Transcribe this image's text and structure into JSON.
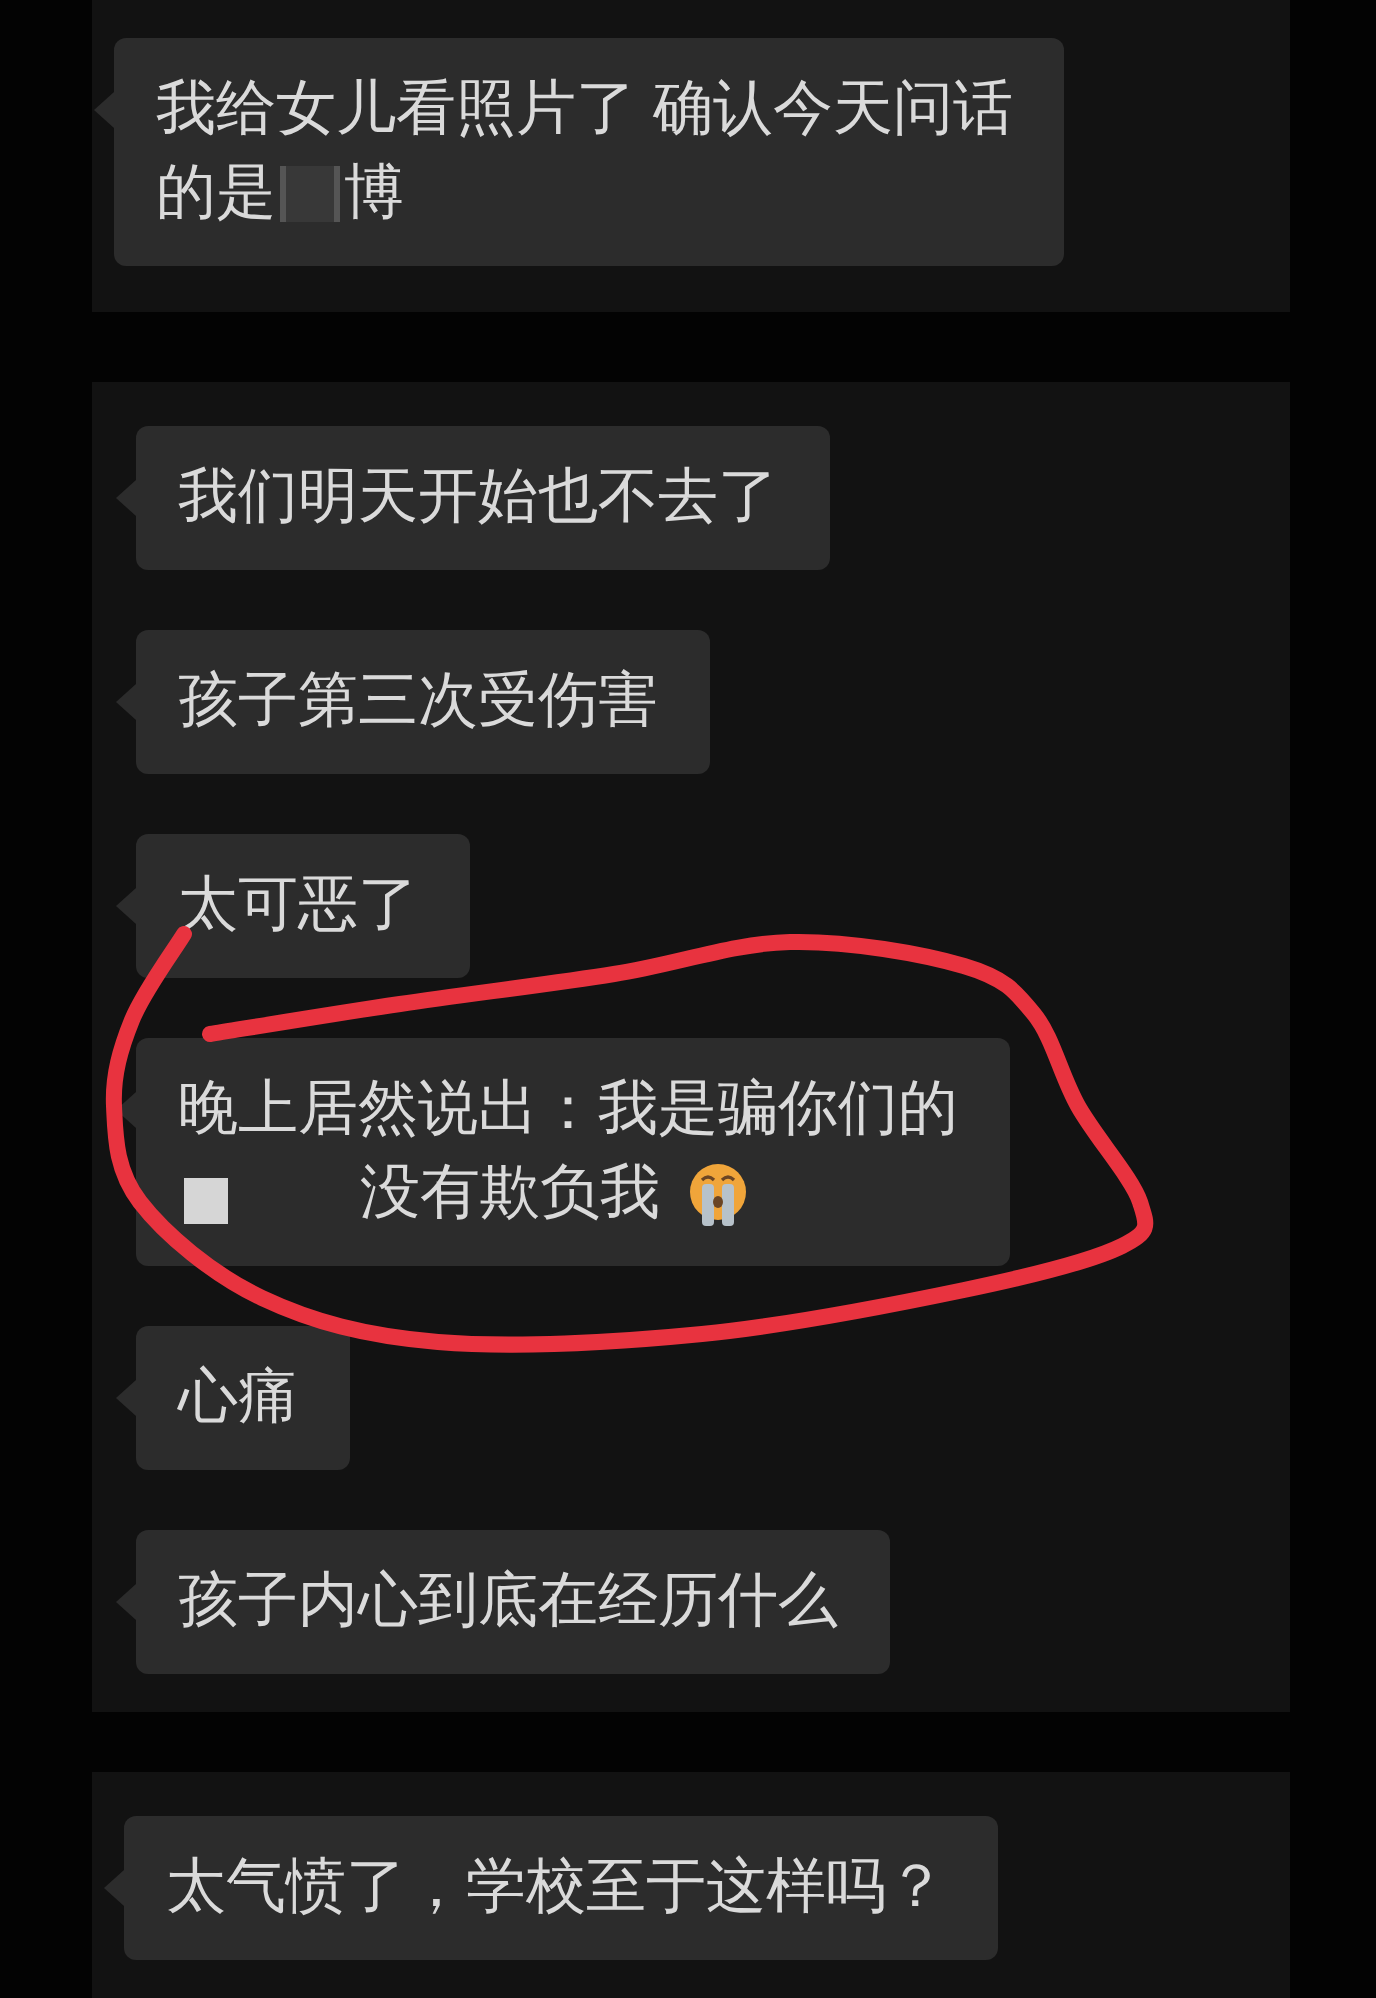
{
  "screenshots": [
    {
      "messages": [
        {
          "circled": false,
          "lines": [
            [
              {
                "kind": "text",
                "text": "我给女儿看照片了 确认今天问话"
              }
            ],
            [
              {
                "kind": "text",
                "text": "的是"
              },
              {
                "kind": "blur"
              },
              {
                "kind": "text",
                "text": "博"
              }
            ]
          ]
        }
      ]
    },
    {
      "messages": [
        {
          "circled": false,
          "lines": [
            [
              {
                "kind": "text",
                "text": "我们明天开始也不去了"
              }
            ]
          ]
        },
        {
          "circled": false,
          "lines": [
            [
              {
                "kind": "text",
                "text": "孩子第三次受伤害"
              }
            ]
          ]
        },
        {
          "circled": false,
          "lines": [
            [
              {
                "kind": "text",
                "text": "太可恶了"
              }
            ]
          ]
        },
        {
          "circled": true,
          "lines": [
            [
              {
                "kind": "text",
                "text": "晚上居然说出：我是骗你们的"
              }
            ],
            [
              {
                "kind": "block"
              },
              {
                "kind": "text",
                "text": "没有欺负我"
              },
              {
                "kind": "emoji"
              }
            ]
          ]
        },
        {
          "circled": false,
          "lines": [
            [
              {
                "kind": "text",
                "text": "心痛"
              }
            ]
          ]
        },
        {
          "circled": false,
          "lines": [
            [
              {
                "kind": "text",
                "text": "孩子内心到底在经历什么"
              }
            ]
          ]
        }
      ]
    },
    {
      "messages": [
        {
          "circled": false,
          "lines": [
            [
              {
                "kind": "text",
                "text": "太气愤了，学校至于这样吗？"
              }
            ]
          ]
        }
      ]
    }
  ]
}
